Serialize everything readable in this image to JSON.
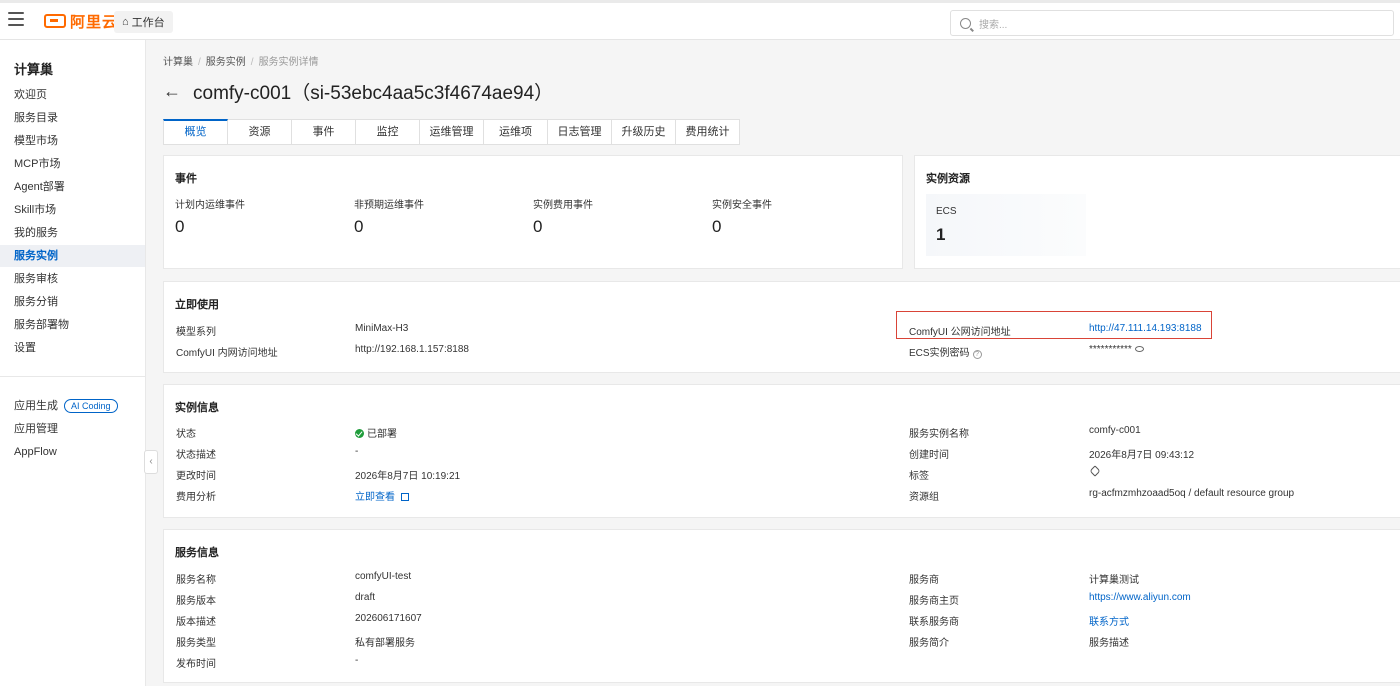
{
  "topbar": {
    "brand": "阿里云",
    "workbench": "工作台",
    "search_placeholder": "搜索..."
  },
  "sidebar": {
    "title": "计算巢",
    "items": [
      {
        "label": "欢迎页"
      },
      {
        "label": "服务目录"
      },
      {
        "label": "模型市场"
      },
      {
        "label": "MCP市场"
      },
      {
        "label": "Agent部署"
      },
      {
        "label": "Skill市场"
      },
      {
        "label": "我的服务"
      },
      {
        "label": "服务实例",
        "active": true
      },
      {
        "label": "服务审核"
      },
      {
        "label": "服务分销"
      },
      {
        "label": "服务部署物"
      },
      {
        "label": "设置"
      }
    ],
    "bottom_items": [
      {
        "label": "应用生成",
        "badge": "AI Coding"
      },
      {
        "label": "应用管理"
      },
      {
        "label": "AppFlow"
      }
    ]
  },
  "breadcrumb": [
    "计算巢",
    "服务实例",
    "服务实例详情"
  ],
  "page_title": "comfy-c001（si-53ebc4aa5c3f4674ae94）",
  "tabs": [
    "概览",
    "资源",
    "事件",
    "监控",
    "运维管理",
    "运维项",
    "日志管理",
    "升级历史",
    "费用统计"
  ],
  "events": {
    "title": "事件",
    "items": [
      {
        "label": "计划内运维事件",
        "value": "0"
      },
      {
        "label": "非预期运维事件",
        "value": "0"
      },
      {
        "label": "实例费用事件",
        "value": "0"
      },
      {
        "label": "实例安全事件",
        "value": "0"
      }
    ]
  },
  "resources": {
    "title": "实例资源",
    "ecs_label": "ECS",
    "ecs_value": "1"
  },
  "quick_use": {
    "title": "立即使用",
    "model_series_label": "模型系列",
    "model_series_value": "MiniMax-H3",
    "inner_url_label": "ComfyUI 内网访问地址",
    "inner_url_value": "http://192.168.1.157:8188",
    "public_url_label": "ComfyUI 公网访问地址",
    "public_url_value": "http://47.111.14.193:8188",
    "ecs_password_label": "ECS实例密码",
    "ecs_password_value": "***********"
  },
  "instance_info": {
    "title": "实例信息",
    "status_label": "状态",
    "status_value": "已部署",
    "status_desc_label": "状态描述",
    "status_desc_value": "-",
    "modified_label": "更改时间",
    "modified_value": "2026年8月7日 10:19:21",
    "cost_label": "费用分析",
    "cost_value": "立即查看",
    "name_label": "服务实例名称",
    "name_value": "comfy-c001",
    "created_label": "创建时间",
    "created_value": "2026年8月7日 09:43:12",
    "tags_label": "标签",
    "rg_label": "资源组",
    "rg_value": "rg-acfmzmhzoaad5oq / default resource group"
  },
  "service_info": {
    "title": "服务信息",
    "name_label": "服务名称",
    "name_value": "comfyUI-test",
    "version_label": "服务版本",
    "version_value": "draft",
    "version_desc_label": "版本描述",
    "version_desc_value": "202606171607",
    "type_label": "服务类型",
    "type_value": "私有部署服务",
    "publish_label": "发布时间",
    "publish_value": "-",
    "provider_label": "服务商",
    "provider_value": "计算巢测试",
    "homepage_label": "服务商主页",
    "homepage_value": "https://www.aliyun.com",
    "contact_label": "联系服务商",
    "contact_value": "联系方式",
    "intro_label": "服务简介",
    "intro_value": "服务描述"
  }
}
